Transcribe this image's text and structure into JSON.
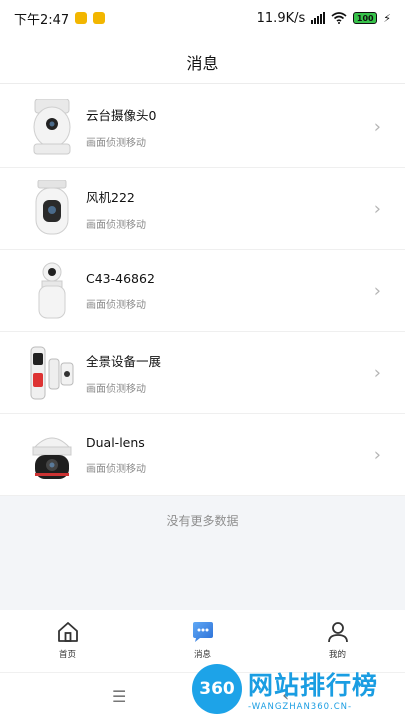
{
  "status_bar": {
    "time": "下午2:47",
    "net_speed": "11.9K/s",
    "battery_level": "100",
    "battery_color": "#37c24a"
  },
  "header": {
    "title": "消息"
  },
  "messages": [
    {
      "name": "云台摄像头0",
      "subtitle": "画面侦测移动",
      "device_icon": "ptz-camera-icon"
    },
    {
      "name": "风机222",
      "subtitle": "画面侦测移动",
      "device_icon": "cylinder-camera-icon"
    },
    {
      "name": "C43-46862",
      "subtitle": "画面侦测移动",
      "device_icon": "stand-camera-icon"
    },
    {
      "name": "全景设备一展",
      "subtitle": "画面侦测移动",
      "device_icon": "panorama-camera-icon"
    },
    {
      "name": "Dual-lens",
      "subtitle": "画面侦测移动",
      "device_icon": "dome-camera-icon"
    }
  ],
  "no_more": "没有更多数据",
  "tabs": [
    {
      "label": "首页",
      "icon": "home-icon"
    },
    {
      "label": "消息",
      "icon": "message-icon",
      "active": true
    },
    {
      "label": "我的",
      "icon": "user-icon"
    }
  ],
  "watermark": {
    "logo": "360",
    "main": "网站排行榜",
    "sub": "-WANGZHAN360.CN-"
  },
  "colors": {
    "accent": "#3a7bd5",
    "watermark": "#1a9de2"
  }
}
